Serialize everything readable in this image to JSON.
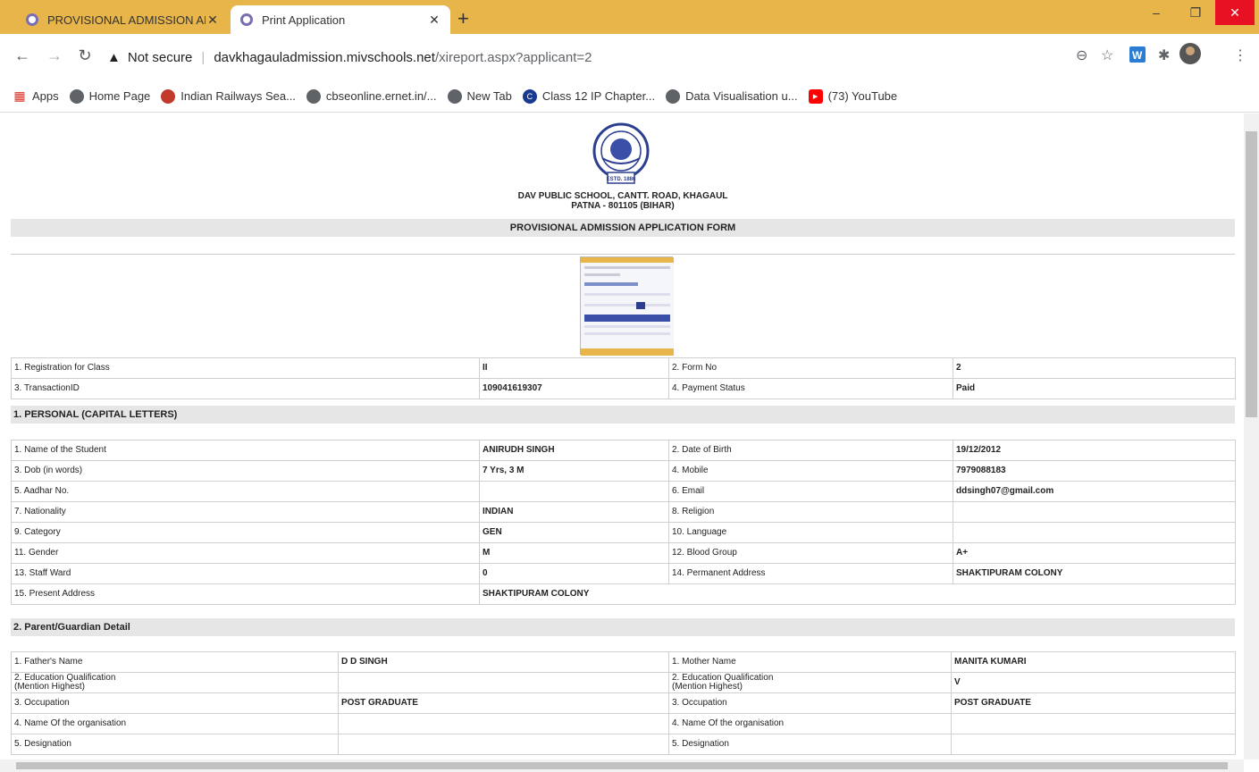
{
  "browser": {
    "tabs": [
      {
        "title": "PROVISIONAL ADMISSION APPLI",
        "active": false
      },
      {
        "title": "Print Application",
        "active": true
      }
    ],
    "security_label": "Not secure",
    "url_host": "davkhagauladmission.mivschools.net",
    "url_path": "/xireport.aspx?applicant=2",
    "bookmarks": [
      {
        "label": "Apps",
        "icon": "apps-grid-icon"
      },
      {
        "label": "Home Page",
        "icon": "globe-icon"
      },
      {
        "label": "Indian Railways Sea...",
        "icon": "railways-icon"
      },
      {
        "label": "cbseonline.ernet.in/...",
        "icon": "globe-icon"
      },
      {
        "label": "New Tab",
        "icon": "globe-icon"
      },
      {
        "label": "Class 12 IP Chapter...",
        "icon": "c-logo-icon"
      },
      {
        "label": "Data Visualisation u...",
        "icon": "globe-icon"
      },
      {
        "label": "(73) YouTube",
        "icon": "youtube-icon"
      }
    ]
  },
  "school": {
    "logo_text": "ESTD. 1886",
    "name_line1": "DAV PUBLIC SCHOOL, CANTT. ROAD, KHAGAUL",
    "name_line2": "PATNA - 801105 (BIHAR)",
    "form_title": "PROVISIONAL ADMISSION APPLICATION FORM"
  },
  "registration": [
    [
      "1. Registration for Class",
      "II",
      "2. Form No",
      "2"
    ],
    [
      "3. TransactionID",
      "109041619307",
      "4. Payment Status",
      "Paid"
    ]
  ],
  "personal": {
    "heading": "1. PERSONAL (CAPITAL LETTERS)",
    "rows": [
      [
        "1. Name of the Student",
        "ANIRUDH SINGH",
        "2. Date of Birth",
        "19/12/2012"
      ],
      [
        "3. Dob (in words)",
        "7 Yrs, 3 M",
        "4. Mobile",
        "7979088183"
      ],
      [
        "5. Aadhar No.",
        "",
        "6. Email",
        "ddsingh07@gmail.com"
      ],
      [
        "7. Nationality",
        "INDIAN",
        "8. Religion",
        ""
      ],
      [
        "9. Category",
        "GEN",
        "10. Language",
        ""
      ],
      [
        "11. Gender",
        "M",
        "12. Blood Group",
        "A+"
      ],
      [
        "13. Staff Ward",
        "0",
        "14. Permanent Address",
        "SHAKTIPURAM COLONY"
      ],
      [
        "15. Present Address",
        "SHAKTIPURAM COLONY",
        "",
        ""
      ]
    ]
  },
  "parents": {
    "heading": "2. Parent/Guardian Detail",
    "rows": [
      [
        "1. Father's Name",
        "D D SINGH",
        "1. Mother Name",
        "MANITA KUMARI"
      ],
      [
        "2. Education Qualification\n(Mention Highest)",
        "",
        "2. Education Qualification\n(Mention Highest)",
        "V"
      ],
      [
        "3. Occupation",
        "POST GRADUATE",
        "3. Occupation",
        "POST GRADUATE"
      ],
      [
        "4. Name Of the organisation",
        "",
        "4. Name Of the organisation",
        ""
      ],
      [
        "5. Designation",
        "",
        "5. Designation",
        ""
      ]
    ]
  }
}
